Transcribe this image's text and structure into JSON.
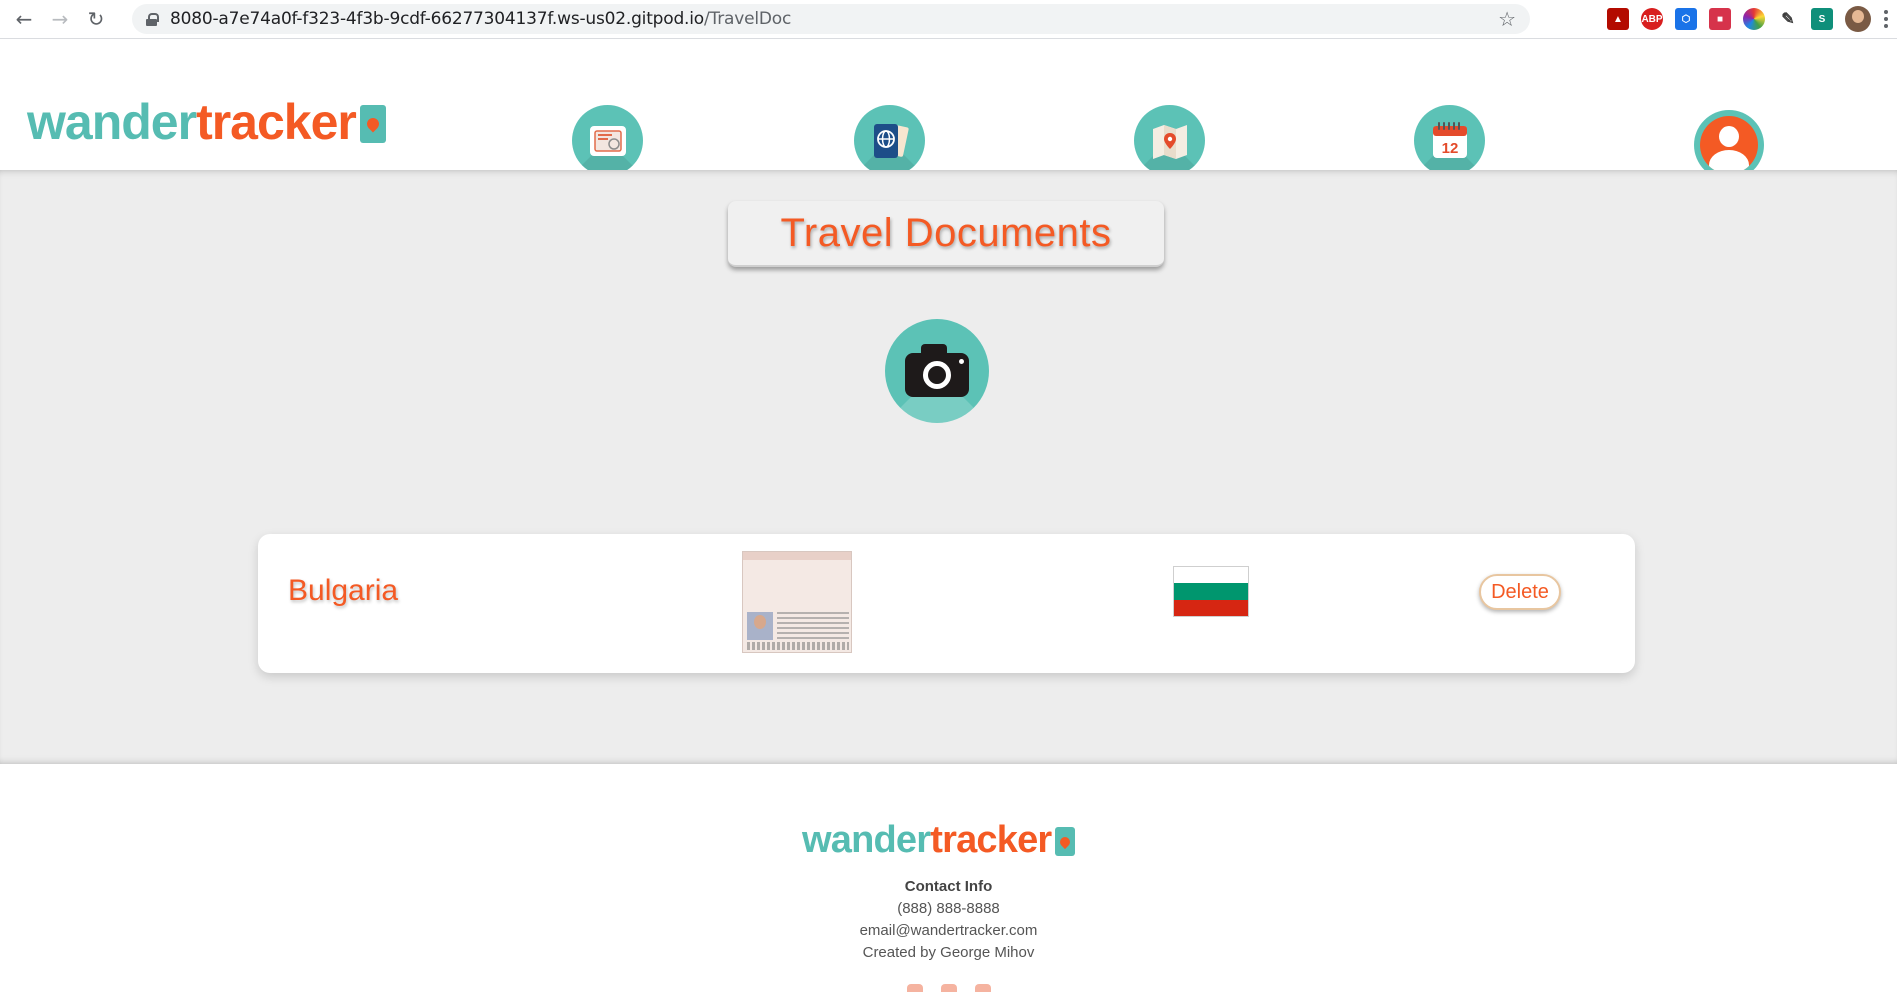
{
  "browser": {
    "url_host": "8080-a7e74a0f-f323-4f3b-9cdf-66277304137f.ws-us02.gitpod.io",
    "url_path": "/TravelDoc",
    "extensions": [
      {
        "name": "acrobat",
        "label": "",
        "color": "#b30b00"
      },
      {
        "name": "adblock",
        "label": "ABP",
        "color": "#d81e1e"
      },
      {
        "name": "ext-cube",
        "label": "",
        "color": "#1a73e8"
      },
      {
        "name": "ext-red",
        "label": "",
        "color": "#d6334b"
      },
      {
        "name": "ext-color",
        "label": "",
        "color": "#7b5cd6"
      },
      {
        "name": "ext-pen",
        "label": "",
        "color": "#3d3d3d"
      },
      {
        "name": "ext-s",
        "label": "S",
        "color": "#0f8f7a"
      }
    ]
  },
  "header": {
    "logo_part1": "wander",
    "logo_part2": "tracker",
    "nav_icons": [
      "travel-documents-icon",
      "passport-icon",
      "map-icon",
      "calendar-icon"
    ],
    "calendar_number": "12"
  },
  "main": {
    "title": "Travel Documents",
    "upload_icon": "camera-icon",
    "documents": [
      {
        "country": "Bulgaria",
        "flag_colors": [
          "#ffffff",
          "#00966e",
          "#d62612"
        ],
        "delete_label": "Delete"
      }
    ]
  },
  "footer": {
    "logo_part1": "wander",
    "logo_part2": "tracker",
    "contact_heading": "Contact Info",
    "phone": "(888) 888-8888",
    "email": "email@wandertracker.com",
    "credit": "Created by George Mihov"
  },
  "colors": {
    "teal": "#56bcb2",
    "orange": "#f45a24",
    "background": "#ededed"
  }
}
